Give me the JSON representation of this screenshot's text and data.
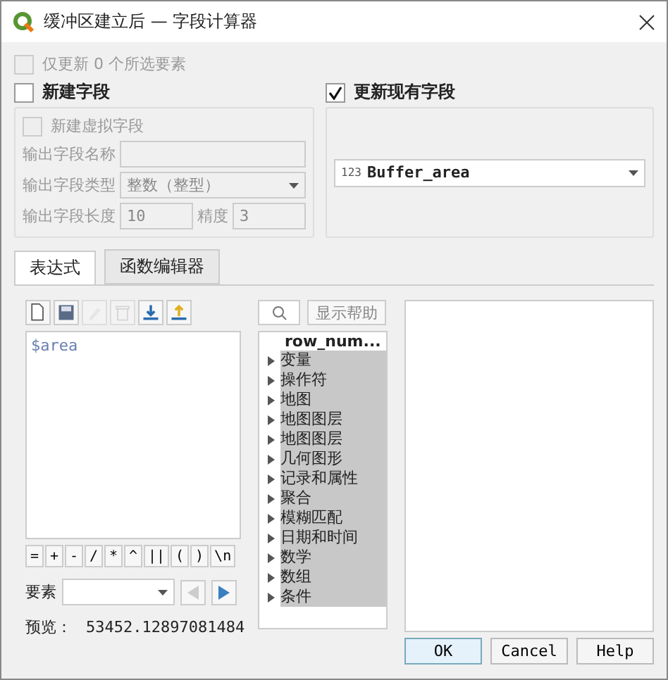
{
  "window": {
    "title": "缓冲区建立后 — 字段计算器"
  },
  "only_selected": {
    "label": "仅更新 0 个所选要素",
    "checked": false,
    "disabled": true
  },
  "new_field": {
    "label": "新建字段",
    "checked": false,
    "virtual": {
      "label": "新建虚拟字段",
      "checked": false
    },
    "name_label": "输出字段名称",
    "type_label": "输出字段类型",
    "type_value": "整数（整型）",
    "length_label": "输出字段长度",
    "length_value": "10",
    "precision_label": "精度",
    "precision_value": "3"
  },
  "update_field": {
    "label": "更新现有字段",
    "checked": true,
    "field_type": "123",
    "field": "Buffer_area"
  },
  "tabs": [
    {
      "label": "表达式",
      "selected": true
    },
    {
      "label": "函数编辑器",
      "selected": false
    }
  ],
  "toolbar": [
    {
      "kind": "new",
      "disabled": false
    },
    {
      "kind": "save",
      "disabled": false
    },
    {
      "kind": "edit",
      "disabled": true
    },
    {
      "kind": "delete",
      "disabled": true
    },
    {
      "kind": "import",
      "disabled": false
    },
    {
      "kind": "export",
      "disabled": false
    }
  ],
  "expression": "$area",
  "operators": [
    "=",
    "+",
    "-",
    "/",
    "*",
    "^",
    "||",
    "(",
    ")",
    "\\n"
  ],
  "feature_label": "要素",
  "preview": {
    "label": "预览：",
    "value": "53452.12897081484"
  },
  "help_button": "显示帮助",
  "tree": {
    "header": "row_num...",
    "groups": [
      "变量",
      "操作符",
      "地图",
      "地图图层",
      "地图图层",
      "几何图形",
      "记录和属性",
      "聚合",
      "模糊匹配",
      "日期和时间",
      "数学",
      "数组",
      "条件"
    ]
  },
  "buttons": [
    {
      "label": "OK",
      "default": true
    },
    {
      "label": "Cancel",
      "default": false
    },
    {
      "label": "Help",
      "default": false
    }
  ]
}
